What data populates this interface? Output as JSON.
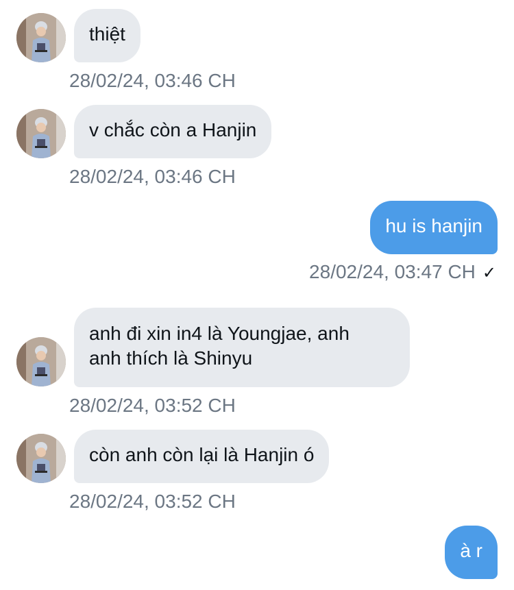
{
  "messages": [
    {
      "side": "in",
      "text": "thiệt",
      "time": "28/02/24, 03:46 CH"
    },
    {
      "side": "in",
      "text": "v chắc còn a Hanjin",
      "time": "28/02/24, 03:46 CH"
    },
    {
      "side": "out",
      "text": "hu is hanjin",
      "time": "28/02/24, 03:47 CH",
      "status": "✓"
    },
    {
      "side": "in",
      "lines": [
        "anh đi xin in4 là Youngjae, anh",
        "anh thích là Shinyu"
      ],
      "time": "28/02/24, 03:52 CH"
    },
    {
      "side": "in",
      "text": "còn anh còn lại là Hanjin ó",
      "time": "28/02/24, 03:52 CH"
    },
    {
      "side": "out",
      "text": "à r"
    }
  ],
  "icons": {
    "avatar": "contact-avatar-photo",
    "read_status": "checkmark-icon"
  },
  "colors": {
    "incoming_bubble": "#e7eaee",
    "outgoing_bubble": "#4c9ce8",
    "timestamp": "#6b7683",
    "text": "#0f1419"
  }
}
